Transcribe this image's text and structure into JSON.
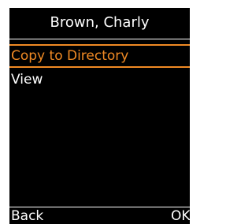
{
  "header": {
    "title": "Brown, Charly"
  },
  "menu": {
    "items": [
      {
        "label": "Copy to Directory",
        "selected": true
      },
      {
        "label": "View",
        "selected": false
      }
    ]
  },
  "softkeys": {
    "left": "Back",
    "right": "OK"
  },
  "colors": {
    "background": "#000000",
    "text": "#ffffff",
    "accent": "#f08a24"
  }
}
